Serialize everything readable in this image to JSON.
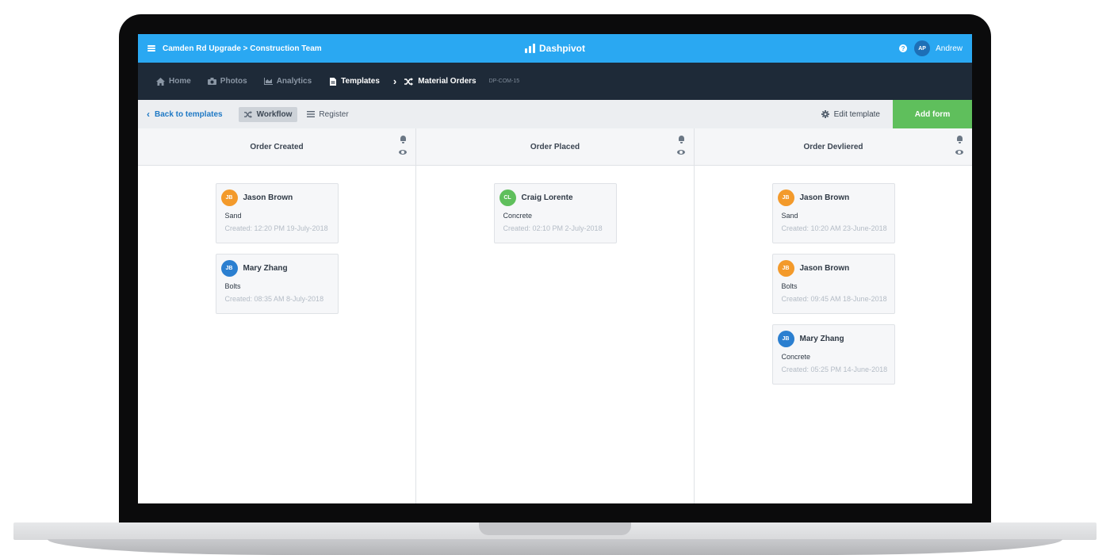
{
  "topbar": {
    "project_title": "Camden Rd Upgrade > Construction Team",
    "brand": "Dashpivot",
    "user_initials": "AP",
    "user_name": "Andrew",
    "help_symbol": "?"
  },
  "nav": {
    "home": "Home",
    "photos": "Photos",
    "analytics": "Analytics",
    "templates": "Templates",
    "current": "Material Orders",
    "code": "DP-COM-15"
  },
  "toolbar": {
    "back": "Back to templates",
    "workflow": "Workflow",
    "register": "Register",
    "edit_template": "Edit template",
    "add_form": "Add form"
  },
  "colors": {
    "accent": "#2aa8f2",
    "nav_bg": "#1e2a38",
    "add_form": "#5fbf5c",
    "avatar_orange": "#f39a2b",
    "avatar_green": "#5fbf5c",
    "avatar_blue": "#2b7fd0"
  },
  "columns": [
    {
      "title": "Order Created",
      "cards": [
        {
          "initials": "JB",
          "name": "Jason Brown",
          "item": "Sand",
          "created": "Created: 12:20 PM 19-July-2018",
          "color": "#f39a2b"
        },
        {
          "initials": "JB",
          "name": "Mary Zhang",
          "item": "Bolts",
          "created": "Created: 08:35 AM 8-July-2018",
          "color": "#2b7fd0"
        }
      ]
    },
    {
      "title": "Order Placed",
      "cards": [
        {
          "initials": "CL",
          "name": "Craig Lorente",
          "item": "Concrete",
          "created": "Created: 02:10 PM 2-July-2018",
          "color": "#5fbf5c"
        }
      ]
    },
    {
      "title": "Order Devliered",
      "cards": [
        {
          "initials": "JB",
          "name": "Jason Brown",
          "item": "Sand",
          "created": "Created: 10:20 AM 23-June-2018",
          "color": "#f39a2b"
        },
        {
          "initials": "JB",
          "name": "Jason Brown",
          "item": "Bolts",
          "created": "Created: 09:45 AM 18-June-2018",
          "color": "#f39a2b"
        },
        {
          "initials": "JB",
          "name": "Mary Zhang",
          "item": "Concrete",
          "created": "Created: 05:25 PM 14-June-2018",
          "color": "#2b7fd0"
        }
      ]
    }
  ]
}
